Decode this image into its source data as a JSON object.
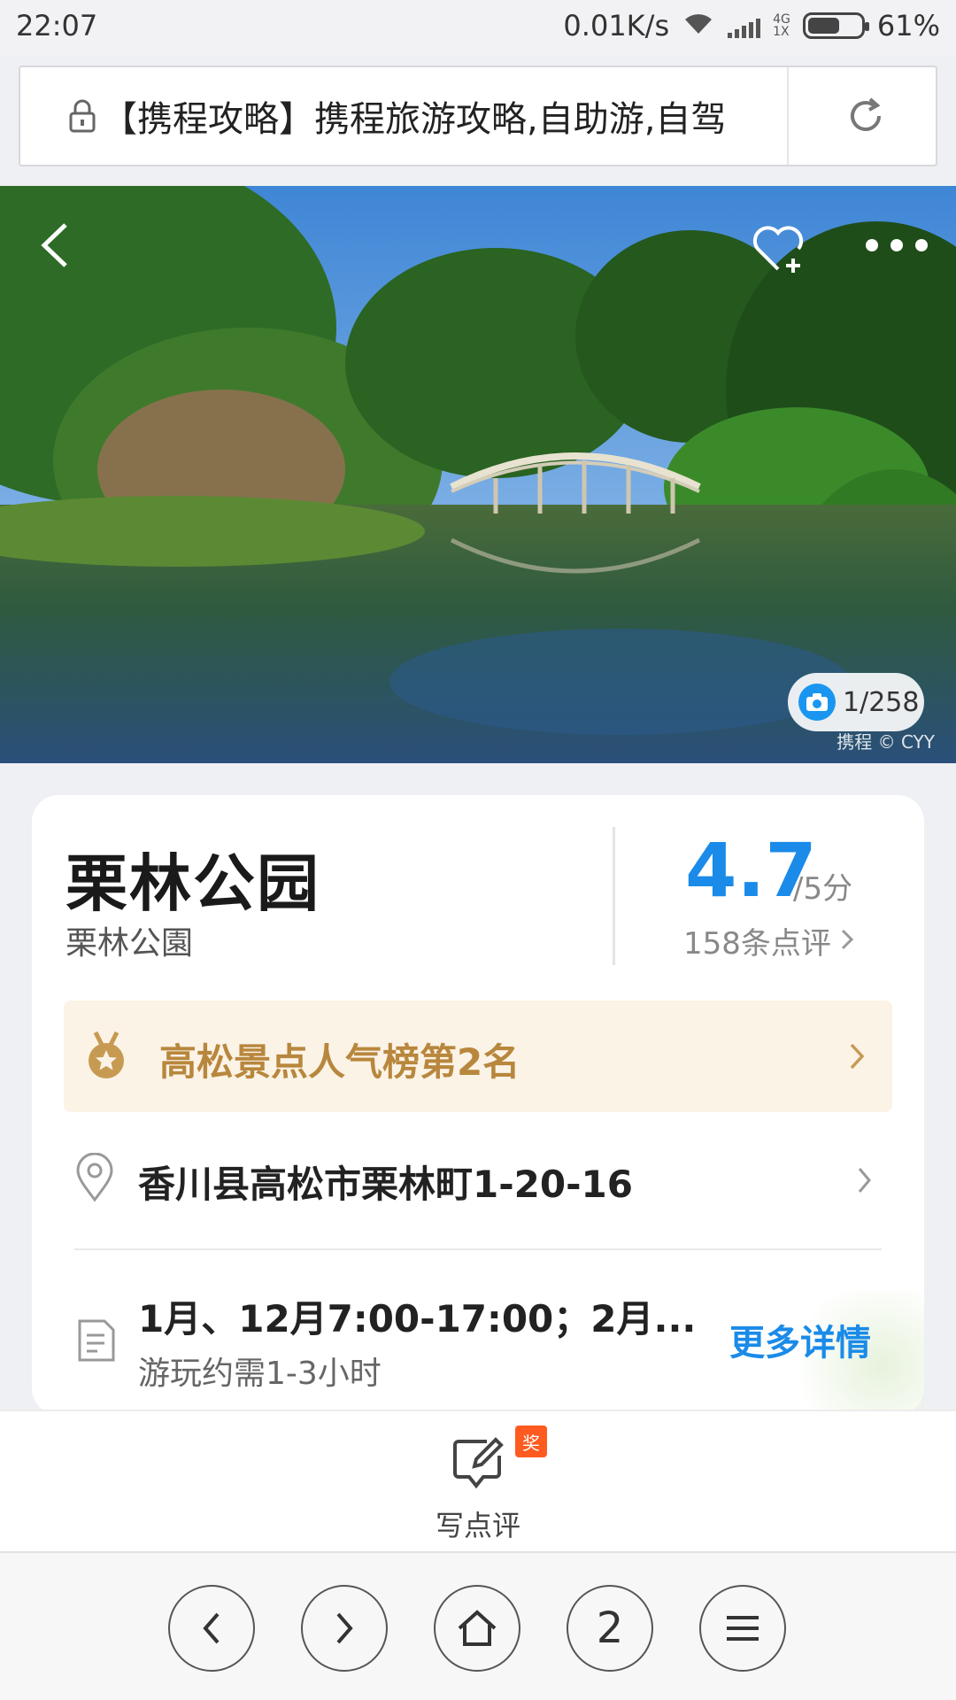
{
  "status_bar": {
    "time": "22:07",
    "speed": "0.01K/s",
    "network_top": "4G",
    "network_bottom": "1X",
    "battery": "61%",
    "battery_level": 0.61
  },
  "browser": {
    "url_title": "【携程攻略】携程旅游攻略,自助游,自驾"
  },
  "hero": {
    "photo_count": "1/258",
    "credit": "携程 © CYY"
  },
  "attraction": {
    "name": "栗林公园",
    "name_local": "栗林公園",
    "score": "4.7",
    "score_total": "/5分",
    "review_count": "158条点评",
    "rank_label": "高松景点人气榜第2名",
    "address": "香川县高松市栗林町1-20-16",
    "hours": "1月、12月7:00-17:00；2月...",
    "duration": "游玩约需1-3小时",
    "more_details": "更多详情"
  },
  "review_bar": {
    "badge": "奖",
    "label": "写点评"
  },
  "nav": {
    "tabs_count": "2"
  },
  "colors": {
    "accent_blue": "#1a8be8",
    "rank_gold": "#b8873d",
    "badge_orange": "#ff5a1f"
  }
}
